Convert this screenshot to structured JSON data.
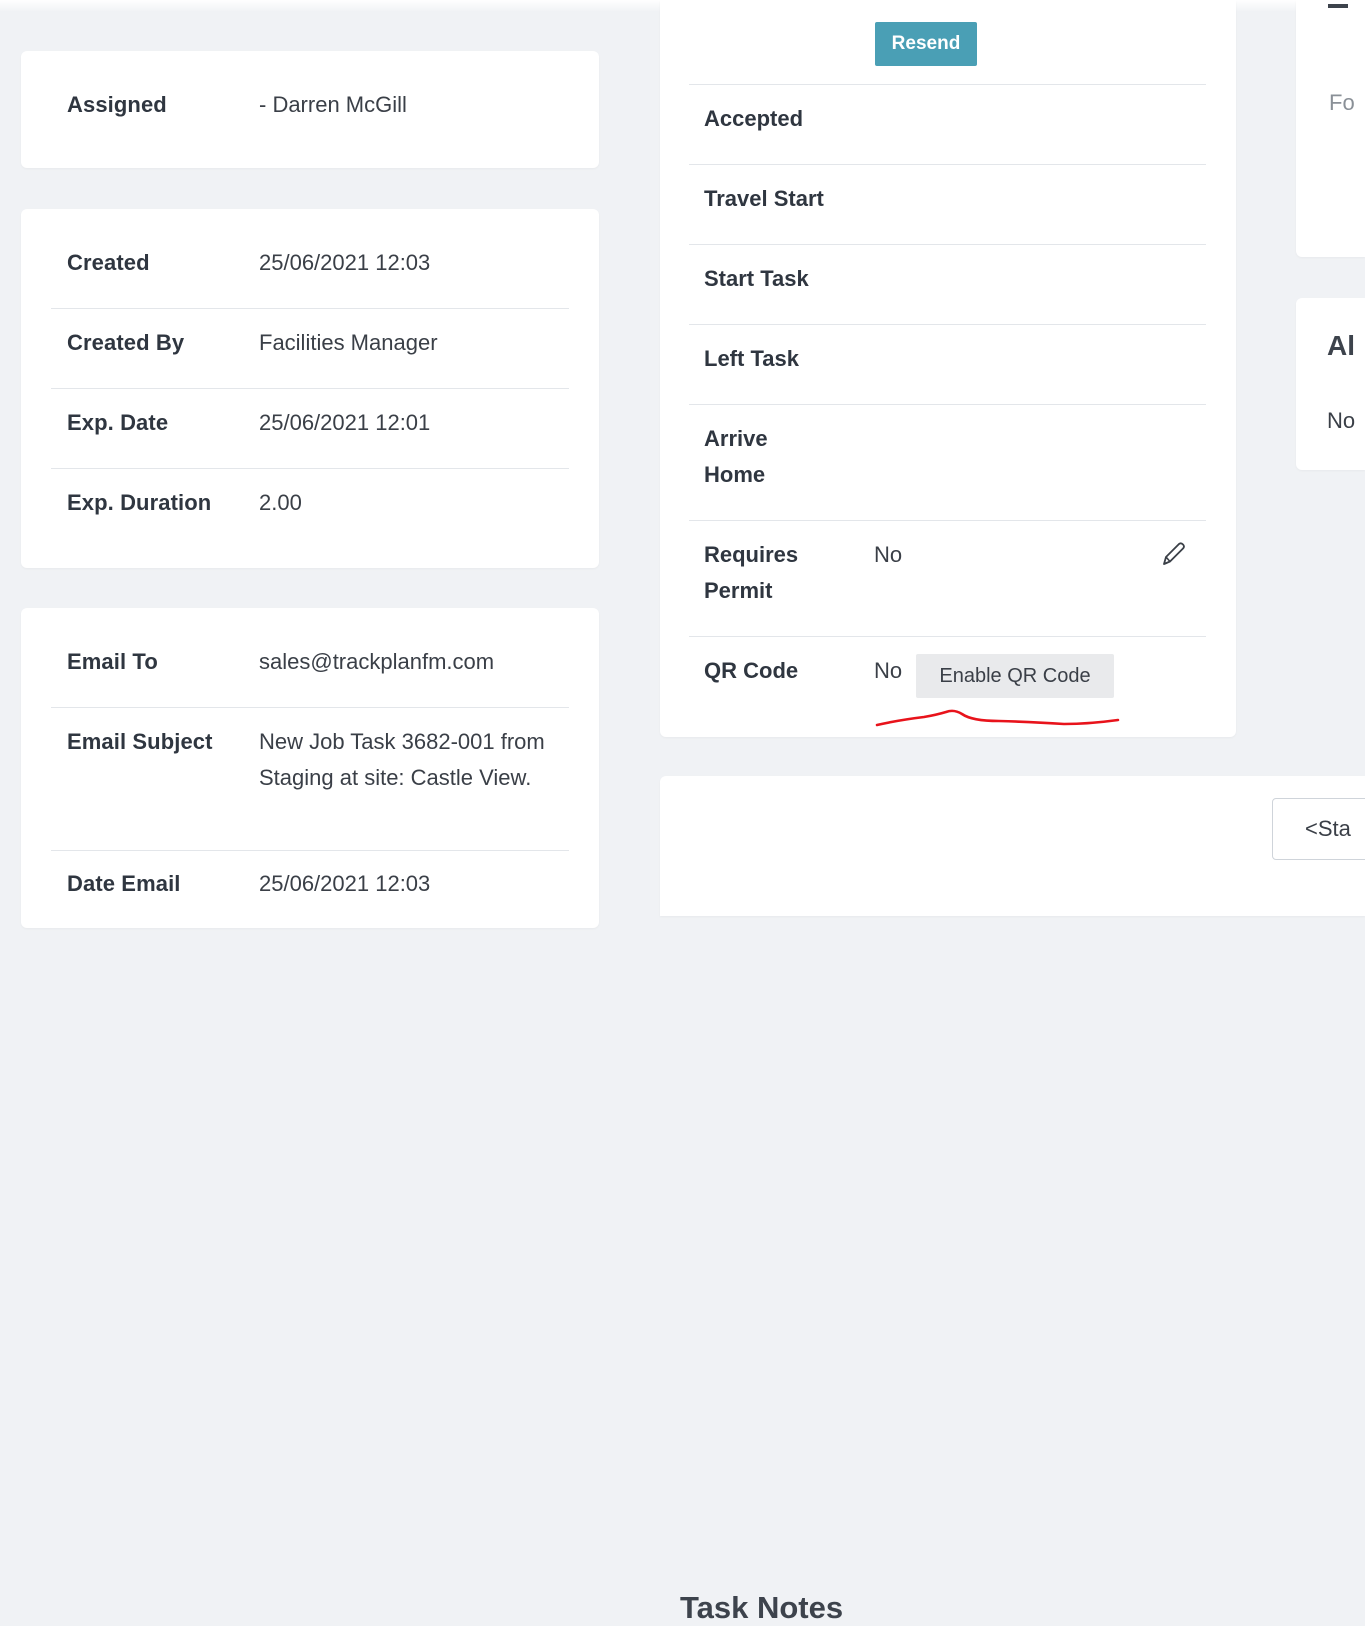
{
  "assigned": {
    "label": "Assigned",
    "value": "- Darren McGill"
  },
  "details": [
    {
      "label": "Created",
      "value": "25/06/2021 12:03"
    },
    {
      "label": "Created By",
      "value": "Facilities Manager"
    },
    {
      "label": "Exp. Date",
      "value": "25/06/2021 12:01"
    },
    {
      "label": "Exp. Duration",
      "value": "2.00"
    }
  ],
  "email": [
    {
      "label": "Email To",
      "value": "sales@trackplanfm.com"
    },
    {
      "label": "Email Subject",
      "value": "New Job Task 3682-001 from Staging at site: Castle View."
    },
    {
      "label": "Date Email",
      "value": "25/06/2021 12:03"
    }
  ],
  "status_panel": {
    "resend_label": "Resend",
    "rows": [
      {
        "label": "Accepted",
        "value": ""
      },
      {
        "label": "Travel Start",
        "value": ""
      },
      {
        "label": "Start Task",
        "value": ""
      },
      {
        "label": "Left Task",
        "value": ""
      },
      {
        "label": "Arrive Home",
        "value": ""
      },
      {
        "label": "Requires Permit",
        "value": "No"
      },
      {
        "label": "QR Code",
        "value": "No"
      }
    ],
    "enable_qr_label": "Enable QR Code",
    "edit_icon": "pencil-icon",
    "annotation_color": "#e8131b"
  },
  "task_notes": {
    "title": "Task Notes",
    "status_select_value": "<Sta"
  },
  "right_panel": {
    "top_text": "Fo",
    "heading": "Al",
    "body_text": "No"
  },
  "colors": {
    "accent": "#4a9fb5",
    "background": "#f0f2f5"
  }
}
